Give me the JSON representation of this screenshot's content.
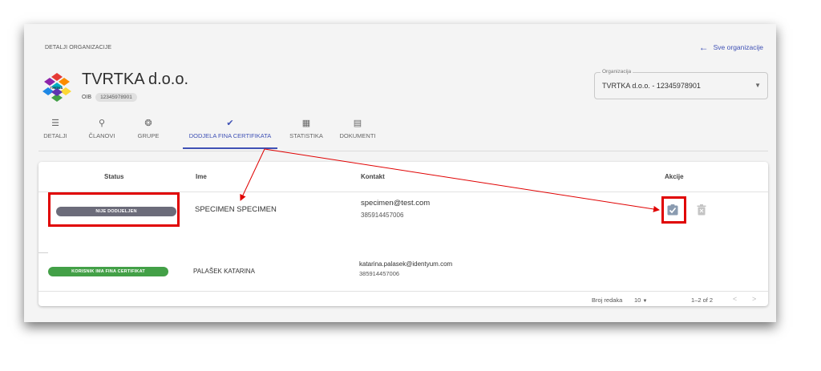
{
  "breadcrumb": "DETALJI ORGANIZACIJE",
  "back_link": "Sve organizacije",
  "org": {
    "name": "TVRTKA d.o.o.",
    "oib_label": "OIB",
    "oib_value": "12345978901",
    "logo_text": "TVRTKA"
  },
  "org_select": {
    "label": "Organizacija",
    "value": "TVRTKA d.o.o. - 12345978901"
  },
  "tabs": [
    {
      "label": "DETALJI",
      "icon": "list-icon",
      "glyph": "☰",
      "active": false
    },
    {
      "label": "ČLANOVI",
      "icon": "user-search-icon",
      "glyph": "⚲",
      "active": false
    },
    {
      "label": "GRUPE",
      "icon": "group-icon",
      "glyph": "❂",
      "active": false
    },
    {
      "label": "DODJELA FINA CERTIFIKATA",
      "icon": "verified-badge-icon",
      "glyph": "✔",
      "active": true
    },
    {
      "label": "STATISTIKA",
      "icon": "chart-icon",
      "glyph": "▦",
      "active": false
    },
    {
      "label": "DOKUMENTI",
      "icon": "document-icon",
      "glyph": "▤",
      "active": false
    }
  ],
  "table": {
    "headers": {
      "status": "Status",
      "name": "Ime",
      "contact": "Kontakt",
      "actions": "Akcije"
    },
    "rows": [
      {
        "status": "NIJE DODIJELJEN",
        "status_color": "#6c6c7a",
        "name": "SPECIMEN SPECIMEN",
        "email": "specimen@test.com",
        "phone": "385914457006"
      },
      {
        "status": "KORISNIK IMA FINA CERTIFIKAT",
        "status_color": "#43a047",
        "name": "PALAŠEK KATARINA",
        "email": "katarina.palasek@identyum.com",
        "phone": "385914457006"
      }
    ],
    "footer": {
      "rows_label": "Broj redaka",
      "rows_value": "10",
      "range": "1–2 of 2"
    }
  },
  "colors": {
    "accent": "#3f51b5",
    "annotation": "#e00000"
  }
}
